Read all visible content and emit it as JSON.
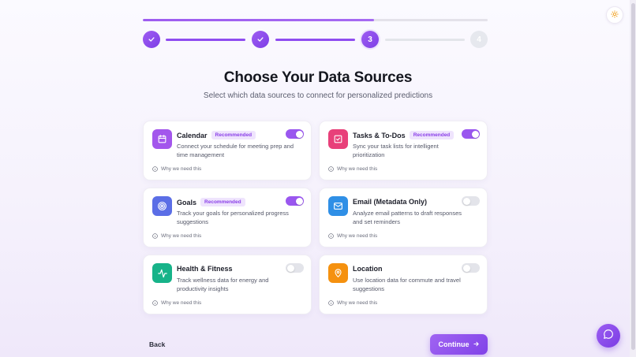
{
  "progress": {
    "fraction": 0.67
  },
  "steps": [
    {
      "label": "",
      "state": "done"
    },
    {
      "label": "",
      "state": "done"
    },
    {
      "label": "3",
      "state": "active"
    },
    {
      "label": "4",
      "state": "todo"
    }
  ],
  "header": {
    "title": "Choose Your Data Sources",
    "subtitle": "Select which data sources to connect for personalized predictions"
  },
  "why_label": "Why we need this",
  "sources": [
    {
      "id": "calendar",
      "title": "Calendar",
      "badge": "Recommended",
      "desc": "Connect your schedule for meeting prep and time management",
      "enabled": true,
      "icon": "calendar-icon",
      "color": "#a356ec"
    },
    {
      "id": "tasks",
      "title": "Tasks & To-Dos",
      "badge": "Recommended",
      "desc": "Sync your task lists for intelligent prioritization",
      "enabled": true,
      "icon": "checkbox-icon",
      "color": "#e8407a"
    },
    {
      "id": "goals",
      "title": "Goals",
      "badge": "Recommended",
      "desc": "Track your goals for personalized progress suggestions",
      "enabled": true,
      "icon": "target-icon",
      "color": "#5b6ee6"
    },
    {
      "id": "email",
      "title": "Email (Metadata Only)",
      "badge": "",
      "desc": "Analyze email patterns to draft responses and set reminders",
      "enabled": false,
      "icon": "mail-icon",
      "color": "#2f8fe6"
    },
    {
      "id": "health",
      "title": "Health & Fitness",
      "badge": "",
      "desc": "Track wellness data for energy and productivity insights",
      "enabled": false,
      "icon": "activity-icon",
      "color": "#17b389"
    },
    {
      "id": "location",
      "title": "Location",
      "badge": "",
      "desc": "Use location data for commute and travel suggestions",
      "enabled": false,
      "icon": "map-pin-icon",
      "color": "#f5910f"
    }
  ],
  "footer": {
    "back_label": "Back",
    "continue_label": "Continue"
  }
}
